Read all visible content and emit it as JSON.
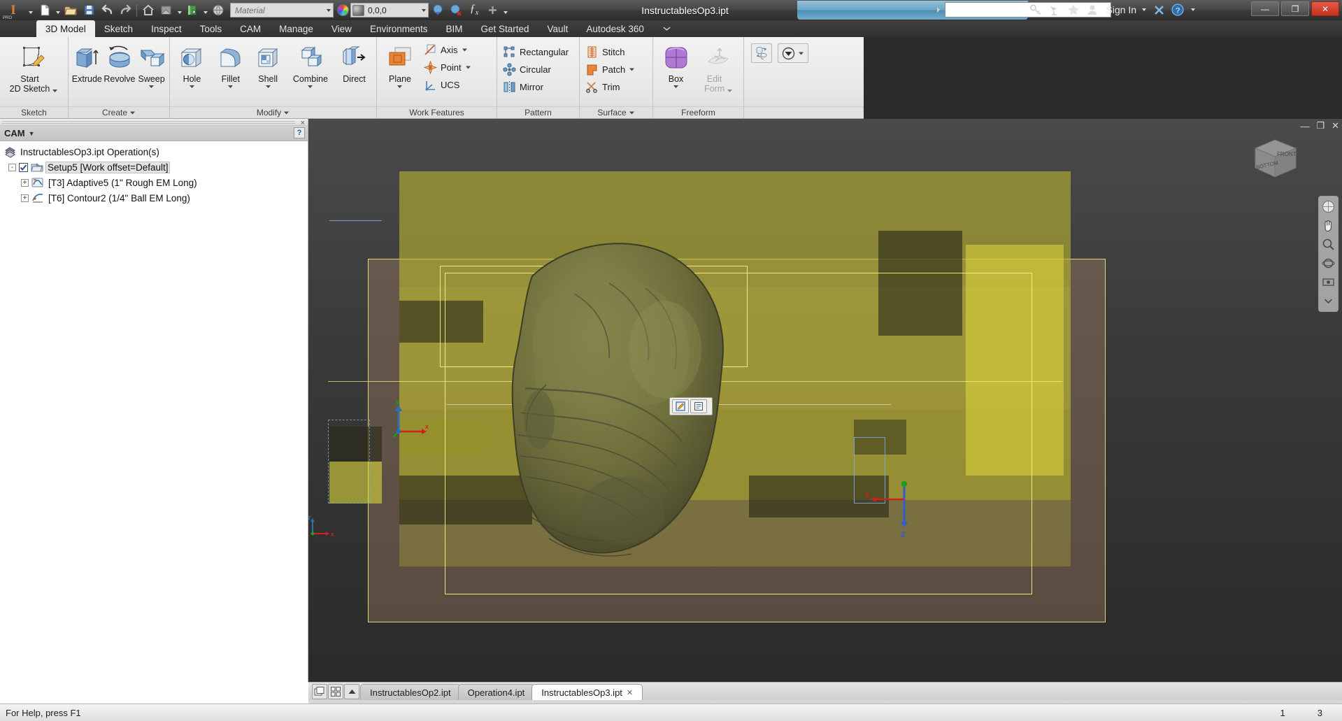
{
  "app": {
    "logo_letter": "I",
    "logo_sub": "PRO",
    "document_title": "InstructablesOp3.ipt"
  },
  "quick_access": {
    "items": [
      {
        "name": "new-file",
        "icon": "new-document-icon",
        "has_arrow": true
      },
      {
        "name": "open-file",
        "icon": "open-folder-icon",
        "has_arrow": false
      },
      {
        "name": "save-file",
        "icon": "floppy-save-icon",
        "has_arrow": false
      },
      {
        "name": "undo",
        "icon": "undo-arrow-icon",
        "has_arrow": false
      },
      {
        "name": "redo",
        "icon": "redo-arrow-icon",
        "has_arrow": false
      },
      {
        "name": "home-view",
        "icon": "home-icon",
        "has_arrow": false
      },
      {
        "name": "view-face",
        "icon": "view-face-icon",
        "has_arrow": true
      },
      {
        "name": "project",
        "icon": "green-book-icon",
        "has_arrow": true
      },
      {
        "name": "appearance-globe",
        "icon": "globe-icon",
        "has_arrow": false
      }
    ],
    "material_value": "Material",
    "appearance_value": "0,0,0",
    "extra_icons": [
      {
        "name": "color-sphere-blue",
        "icon": "color-sphere-icon"
      },
      {
        "name": "color-sphere-clear",
        "icon": "clear-color-icon"
      },
      {
        "name": "parameters-fx",
        "icon": "fx-icon"
      },
      {
        "name": "add-to-toolbar",
        "icon": "plus-icon"
      },
      {
        "name": "customize-qat",
        "icon": "chevron-down-icon"
      }
    ]
  },
  "search": {
    "value": "",
    "placeholder": ""
  },
  "titlebar_right": {
    "icons": [
      {
        "name": "help-key-icon",
        "glyph": "key"
      },
      {
        "name": "satellite-icon",
        "glyph": "satellite"
      },
      {
        "name": "favorites-star-icon",
        "glyph": "star"
      },
      {
        "name": "user-account-icon",
        "glyph": "user"
      }
    ],
    "sign_in": "Sign In",
    "after_sign_in": [
      {
        "name": "exchange-apps-icon",
        "glyph": "x"
      },
      {
        "name": "help-question-icon",
        "glyph": "?"
      }
    ],
    "window_buttons": [
      {
        "name": "minimize-button",
        "glyph": "—"
      },
      {
        "name": "restore-button",
        "glyph": "❐"
      },
      {
        "name": "close-button",
        "glyph": "✕"
      }
    ]
  },
  "ribbon": {
    "tabs": [
      {
        "label": "3D Model",
        "active": true
      },
      {
        "label": "Sketch",
        "active": false
      },
      {
        "label": "Inspect",
        "active": false
      },
      {
        "label": "Tools",
        "active": false
      },
      {
        "label": "CAM",
        "active": false
      },
      {
        "label": "Manage",
        "active": false
      },
      {
        "label": "View",
        "active": false
      },
      {
        "label": "Environments",
        "active": false
      },
      {
        "label": "BIM",
        "active": false
      },
      {
        "label": "Get Started",
        "active": false
      },
      {
        "label": "Vault",
        "active": false
      },
      {
        "label": "Autodesk 360",
        "active": false
      }
    ],
    "panels": [
      {
        "name": "sketch",
        "label": "Sketch",
        "big_buttons": [
          {
            "label": "Start\n2D Sketch",
            "icon": "start-2d-sketch-icon",
            "caret": true
          }
        ],
        "small_buttons": []
      },
      {
        "name": "create",
        "label": "Create",
        "label_caret": true,
        "big_buttons": [
          {
            "label": "Extrude",
            "icon": "extrude-icon",
            "caret": false
          },
          {
            "label": "Revolve",
            "icon": "revolve-icon",
            "caret": false
          },
          {
            "label": "Sweep",
            "icon": "sweep-icon",
            "caret": true
          }
        ],
        "small_buttons": []
      },
      {
        "name": "modify",
        "label": "Modify",
        "label_caret": true,
        "big_buttons": [
          {
            "label": "Hole",
            "icon": "hole-icon",
            "caret": true
          },
          {
            "label": "Fillet",
            "icon": "fillet-icon",
            "caret": true
          },
          {
            "label": "Shell",
            "icon": "shell-icon",
            "caret": true
          },
          {
            "label": "Combine",
            "icon": "combine-icon",
            "caret": true
          },
          {
            "label": "Direct",
            "icon": "direct-edit-icon",
            "caret": false
          }
        ],
        "small_buttons": []
      },
      {
        "name": "work-features",
        "label": "Work Features",
        "big_buttons": [
          {
            "label": "Plane",
            "icon": "work-plane-icon",
            "caret": true
          }
        ],
        "small_buttons": [
          {
            "label": "Axis",
            "icon": "work-axis-icon",
            "caret": true
          },
          {
            "label": "Point",
            "icon": "work-point-icon",
            "caret": true
          },
          {
            "label": "UCS",
            "icon": "ucs-icon",
            "caret": false
          }
        ]
      },
      {
        "name": "pattern",
        "label": "Pattern",
        "big_buttons": [],
        "small_buttons": [
          {
            "label": "Rectangular",
            "icon": "rectangular-pattern-icon",
            "caret": false
          },
          {
            "label": "Circular",
            "icon": "circular-pattern-icon",
            "caret": false
          },
          {
            "label": "Mirror",
            "icon": "mirror-icon",
            "caret": false
          }
        ]
      },
      {
        "name": "surface",
        "label": "Surface",
        "label_caret": true,
        "big_buttons": [],
        "small_buttons": [
          {
            "label": "Stitch",
            "icon": "stitch-icon",
            "caret": false
          },
          {
            "label": "Patch",
            "icon": "patch-icon",
            "caret": true
          },
          {
            "label": "Trim",
            "icon": "trim-scissors-icon",
            "caret": false
          }
        ]
      },
      {
        "name": "freeform",
        "label": "Freeform",
        "big_buttons": [
          {
            "label": "Box",
            "icon": "freeform-box-icon",
            "caret": true
          },
          {
            "label": "Edit\nForm",
            "icon": "edit-form-icon",
            "caret": true,
            "disabled": true
          }
        ],
        "small_buttons": []
      },
      {
        "name": "convert",
        "label": "",
        "big_buttons": [],
        "small_buttons": [],
        "tiny_buttons": [
          {
            "name": "convert-to-sheetmetal",
            "icon": "convert-icon"
          }
        ],
        "combo_buttons": [
          {
            "name": "appearance-override",
            "icon": "appearance-dropdown-icon"
          }
        ]
      }
    ]
  },
  "browser": {
    "header_title": "CAM",
    "header_caret": "▼",
    "help_glyph": "?",
    "close_glyph": "×",
    "tree": [
      {
        "label": "InstructablesOp3.ipt Operation(s)",
        "icon": "cam-document-icon",
        "indent": 0,
        "expander": "",
        "checkbox": false,
        "selected": false
      },
      {
        "label": "Setup5 [Work offset=Default]",
        "icon": "setup-folder-icon",
        "indent": 1,
        "expander": "-",
        "checkbox": true,
        "checked": true,
        "selected": true
      },
      {
        "label": "[T3] Adaptive5 (1\" Rough EM Long)",
        "icon": "adaptive-operation-icon",
        "indent": 2,
        "expander": "+",
        "checkbox": false,
        "selected": false
      },
      {
        "label": "[T6] Contour2 (1/4\" Ball EM Long)",
        "icon": "contour-operation-icon",
        "indent": 2,
        "expander": "+",
        "checkbox": false,
        "selected": false
      }
    ]
  },
  "viewport": {
    "window_buttons": [
      "—",
      "❐",
      "✕"
    ],
    "viewcube": {
      "front": "FRONT",
      "bottom": "BOTTOM"
    },
    "mini_toolbar": [
      {
        "name": "mini-edit-button",
        "icon": "pencil-edit-icon"
      },
      {
        "name": "mini-properties-button",
        "icon": "properties-icon"
      }
    ],
    "nav_tools": [
      {
        "name": "steering-wheel-tool",
        "icon": "steering-wheel-icon"
      },
      {
        "name": "pan-tool",
        "icon": "hand-pan-icon"
      },
      {
        "name": "zoom-tool",
        "icon": "magnifier-zoom-icon"
      },
      {
        "name": "orbit-tool",
        "icon": "orbit-icon"
      },
      {
        "name": "look-at-tool",
        "icon": "look-at-icon"
      },
      {
        "name": "nav-settings",
        "icon": "chevron-down-icon"
      }
    ],
    "origin_axes": {
      "world": {
        "x": "x",
        "y": "y",
        "z": "z"
      },
      "setup": {
        "x": "X",
        "y": "Y",
        "z": "Z"
      }
    }
  },
  "doc_tabs": {
    "left_icons": [
      {
        "name": "cascade-windows-icon",
        "glyph": "cascade"
      },
      {
        "name": "tile-windows-icon",
        "glyph": "tile"
      },
      {
        "name": "scroll-tabs-up-icon",
        "glyph": "▲"
      }
    ],
    "tabs": [
      {
        "label": "InstructablesOp2.ipt",
        "active": false,
        "closable": false
      },
      {
        "label": "Operation4.ipt",
        "active": false,
        "closable": false
      },
      {
        "label": "InstructablesOp3.ipt",
        "active": true,
        "closable": true,
        "close_glyph": "✕"
      }
    ]
  },
  "status_bar": {
    "message": "For Help, press F1",
    "field_1": "1",
    "field_2": "3"
  }
}
